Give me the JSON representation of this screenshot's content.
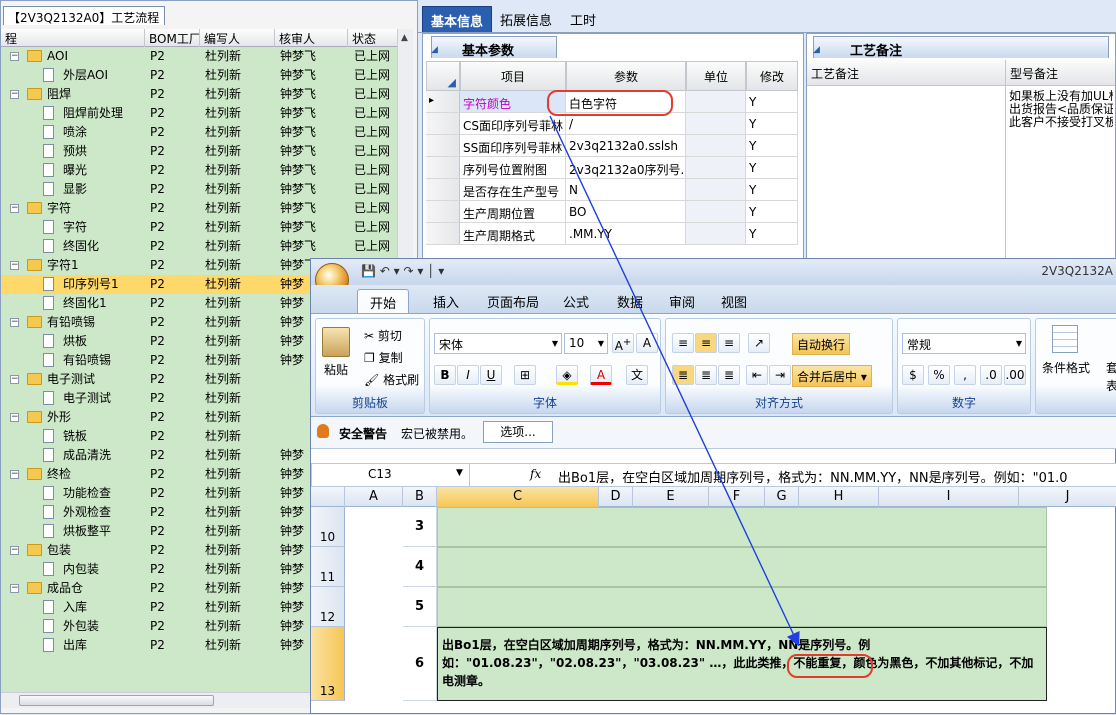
{
  "left": {
    "title": "【2V3Q2132A0】工艺流程",
    "headers": [
      "程",
      "BOM工厂",
      "编写人",
      "核审人",
      "状态"
    ],
    "rows": [
      {
        "level": 0,
        "name": "AOI",
        "bom": "P2",
        "writer": "杜列新",
        "reviewer": "钟梦飞",
        "status": "已上网"
      },
      {
        "level": 1,
        "name": "外层AOI",
        "bom": "P2",
        "writer": "杜列新",
        "reviewer": "钟梦飞",
        "status": "已上网"
      },
      {
        "level": 0,
        "name": "阻焊",
        "bom": "P2",
        "writer": "杜列新",
        "reviewer": "钟梦飞",
        "status": "已上网"
      },
      {
        "level": 1,
        "name": "阻焊前处理",
        "bom": "P2",
        "writer": "杜列新",
        "reviewer": "钟梦飞",
        "status": "已上网"
      },
      {
        "level": 1,
        "name": "喷涂",
        "bom": "P2",
        "writer": "杜列新",
        "reviewer": "钟梦飞",
        "status": "已上网"
      },
      {
        "level": 1,
        "name": "预烘",
        "bom": "P2",
        "writer": "杜列新",
        "reviewer": "钟梦飞",
        "status": "已上网"
      },
      {
        "level": 1,
        "name": "曝光",
        "bom": "P2",
        "writer": "杜列新",
        "reviewer": "钟梦飞",
        "status": "已上网"
      },
      {
        "level": 1,
        "name": "显影",
        "bom": "P2",
        "writer": "杜列新",
        "reviewer": "钟梦飞",
        "status": "已上网"
      },
      {
        "level": 0,
        "name": "字符",
        "bom": "P2",
        "writer": "杜列新",
        "reviewer": "钟梦飞",
        "status": "已上网"
      },
      {
        "level": 1,
        "name": "字符",
        "bom": "P2",
        "writer": "杜列新",
        "reviewer": "钟梦飞",
        "status": "已上网"
      },
      {
        "level": 1,
        "name": "终固化",
        "bom": "P2",
        "writer": "杜列新",
        "reviewer": "钟梦飞",
        "status": "已上网"
      },
      {
        "level": 0,
        "name": "字符1",
        "bom": "P2",
        "writer": "杜列新",
        "reviewer": "钟梦飞",
        "status": "已上网"
      },
      {
        "level": 1,
        "name": "印序列号1",
        "bom": "P2",
        "writer": "杜列新",
        "reviewer": "钟梦",
        "status": "",
        "selected": true
      },
      {
        "level": 1,
        "name": "终固化1",
        "bom": "P2",
        "writer": "杜列新",
        "reviewer": "钟梦",
        "status": ""
      },
      {
        "level": 0,
        "name": "有铅喷锡",
        "bom": "P2",
        "writer": "杜列新",
        "reviewer": "钟梦",
        "status": ""
      },
      {
        "level": 1,
        "name": "烘板",
        "bom": "P2",
        "writer": "杜列新",
        "reviewer": "钟梦",
        "status": ""
      },
      {
        "level": 1,
        "name": "有铅喷锡",
        "bom": "P2",
        "writer": "杜列新",
        "reviewer": "钟梦",
        "status": ""
      },
      {
        "level": 0,
        "name": "电子测试",
        "bom": "P2",
        "writer": "杜列新",
        "reviewer": "",
        "status": ""
      },
      {
        "level": 1,
        "name": "电子测试",
        "bom": "P2",
        "writer": "杜列新",
        "reviewer": "",
        "status": ""
      },
      {
        "level": 0,
        "name": "外形",
        "bom": "P2",
        "writer": "杜列新",
        "reviewer": "",
        "status": ""
      },
      {
        "level": 1,
        "name": "铣板",
        "bom": "P2",
        "writer": "杜列新",
        "reviewer": "",
        "status": ""
      },
      {
        "level": 1,
        "name": "成品清洗",
        "bom": "P2",
        "writer": "杜列新",
        "reviewer": "钟梦",
        "status": ""
      },
      {
        "level": 0,
        "name": "终检",
        "bom": "P2",
        "writer": "杜列新",
        "reviewer": "钟梦",
        "status": ""
      },
      {
        "level": 1,
        "name": "功能检查",
        "bom": "P2",
        "writer": "杜列新",
        "reviewer": "钟梦",
        "status": ""
      },
      {
        "level": 1,
        "name": "外观检查",
        "bom": "P2",
        "writer": "杜列新",
        "reviewer": "钟梦",
        "status": ""
      },
      {
        "level": 1,
        "name": "烘板整平",
        "bom": "P2",
        "writer": "杜列新",
        "reviewer": "钟梦",
        "status": ""
      },
      {
        "level": 0,
        "name": "包装",
        "bom": "P2",
        "writer": "杜列新",
        "reviewer": "钟梦",
        "status": ""
      },
      {
        "level": 1,
        "name": "内包装",
        "bom": "P2",
        "writer": "杜列新",
        "reviewer": "钟梦",
        "status": ""
      },
      {
        "level": 0,
        "name": "成品仓",
        "bom": "P2",
        "writer": "杜列新",
        "reviewer": "钟梦",
        "status": ""
      },
      {
        "level": 1,
        "name": "入库",
        "bom": "P2",
        "writer": "杜列新",
        "reviewer": "钟梦",
        "status": ""
      },
      {
        "level": 1,
        "name": "外包装",
        "bom": "P2",
        "writer": "杜列新",
        "reviewer": "钟梦",
        "status": ""
      },
      {
        "level": 1,
        "name": "出库",
        "bom": "P2",
        "writer": "杜列新",
        "reviewer": "钟梦",
        "status": ""
      }
    ]
  },
  "top_tabs": [
    "基本信息",
    "拓展信息",
    "工时"
  ],
  "basic": {
    "tab": "基本参数",
    "headers": [
      "项目",
      "参数",
      "单位",
      "修改"
    ],
    "rows": [
      {
        "item": "字符颜色",
        "param": "白色字符",
        "unit": "",
        "mod": "Y"
      },
      {
        "item": "CS面印序列号菲林",
        "param": "/",
        "unit": "",
        "mod": "Y"
      },
      {
        "item": "SS面印序列号菲林",
        "param": "2v3q2132a0.sslsh",
        "unit": "",
        "mod": "Y"
      },
      {
        "item": "序列号位置附图",
        "param": "2v3q2132a0序列号...",
        "unit": "",
        "mod": "Y"
      },
      {
        "item": "是否存在生产型号",
        "param": "N",
        "unit": "",
        "mod": "Y"
      },
      {
        "item": "生产周期位置",
        "param": "BO",
        "unit": "",
        "mod": "Y"
      },
      {
        "item": "生产周期格式",
        "param": ".MM.YY",
        "unit": "",
        "mod": "Y"
      }
    ]
  },
  "remark": {
    "tab": "工艺备注",
    "col1": "工艺备注",
    "col2": "型号备注",
    "text_lines": [
      "如果板上没有加UL标",
      "出货报告<品质保证书",
      "此客户不接受打叉板"
    ]
  },
  "excel": {
    "title": "2V3Q2132A",
    "tabs": [
      "开始",
      "插入",
      "页面布局",
      "公式",
      "数据",
      "审阅",
      "视图"
    ],
    "clipboard": {
      "paste": "粘贴",
      "cut": "剪切",
      "copy": "复制",
      "painter": "格式刷",
      "label": "剪贴板"
    },
    "font": {
      "name": "宋体",
      "size": "10",
      "label": "字体"
    },
    "align": {
      "wrap": "自动换行",
      "merge": "合并后居中",
      "label": "对齐方式"
    },
    "number": {
      "format": "常规",
      "label": "数字",
      "percent": "%",
      "comma": ","
    },
    "styles": {
      "cond": "条件格式",
      "table": "表格",
      "label": "套"
    },
    "warning": {
      "title": "安全警告",
      "msg": "宏已被禁用。",
      "button": "选项..."
    },
    "namebox": "C13",
    "formula": "出Bo1层，在空白区域加周期序列号，格式为：NN.MM.YY，NN是序列号。例如：\"01.0",
    "columns": [
      "A",
      "B",
      "C",
      "D",
      "E",
      "F",
      "G",
      "H",
      "I",
      "J"
    ],
    "rows": [
      {
        "row": "10",
        "b": "3",
        "c": ""
      },
      {
        "row": "11",
        "b": "4",
        "c": ""
      },
      {
        "row": "12",
        "b": "5",
        "c": ""
      },
      {
        "row": "13",
        "b": "6",
        "c": "出Bo1层，在空白区域加周期序列号，格式为：NN.MM.YY，NN是序列号。例如：\"01.08.23\"，\"02.08.23\"，\"03.08.23\" …，此此类推，不能重复，颜色为黑色，不加其他标记，不加电测章。"
      }
    ]
  },
  "colors": {
    "accent": "#2a5fb0",
    "highlight_oval": "#e43c2c",
    "arrow": "#1f3fe0",
    "tree_bg": "#cde8c8",
    "selected_row": "#ffd86a"
  }
}
